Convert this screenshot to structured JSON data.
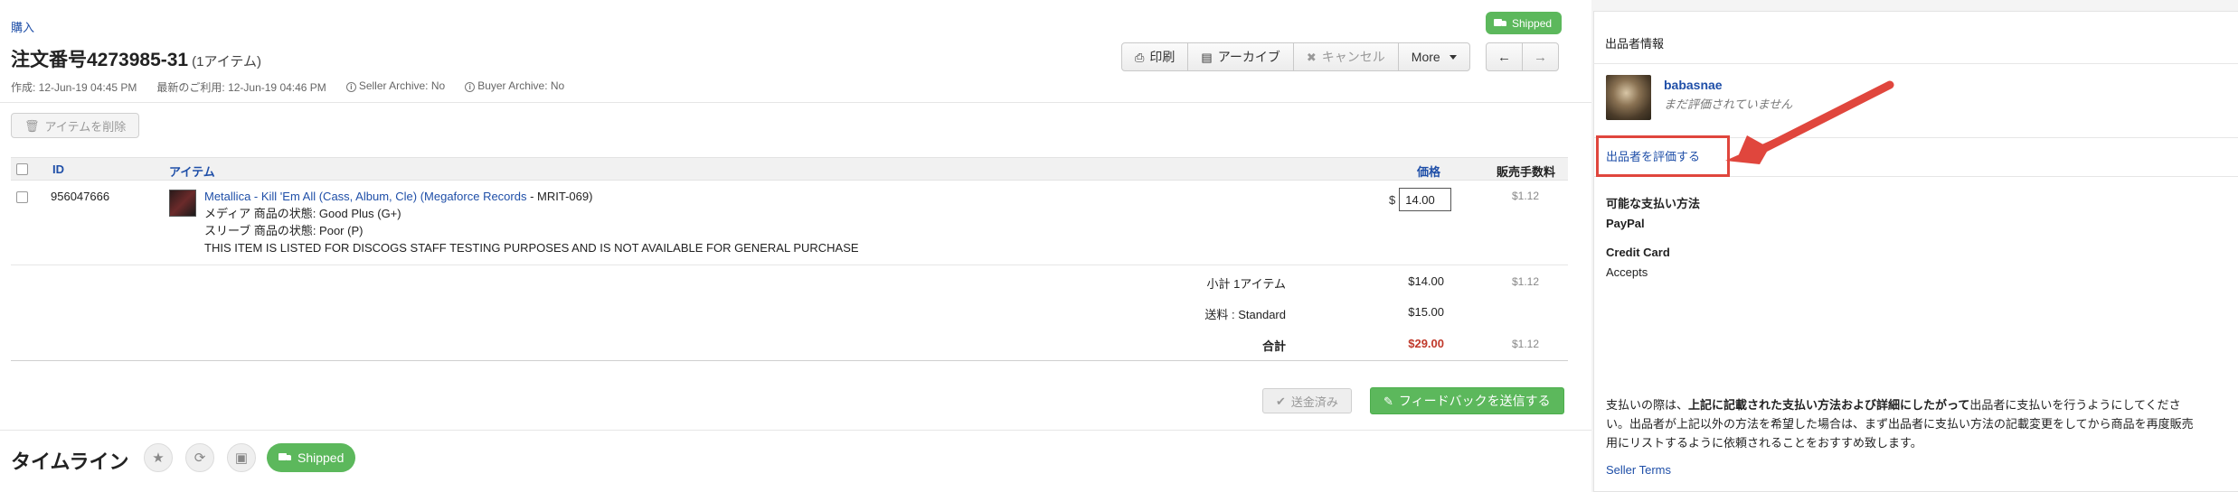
{
  "breadcrumb": "購入",
  "status_badge": "Shipped",
  "order": {
    "title": "注文番号4273985-31",
    "count": "(1アイテム)"
  },
  "toolbar": {
    "print": "印刷",
    "archive": "アーカイブ",
    "cancel": "キャンセル",
    "more": "More",
    "prev": "←",
    "next": "→"
  },
  "meta": {
    "created": "作成: 12-Jun-19 04:45 PM",
    "last_used": "最新のご利用: 12-Jun-19 04:46 PM",
    "seller_archive": "Seller Archive: No",
    "buyer_archive": "Buyer Archive: No"
  },
  "delete_items": "アイテムを削除",
  "table": {
    "headers": {
      "id": "ID",
      "item": "アイテム",
      "price": "価格",
      "fee": "販売手数料"
    },
    "rows": [
      {
        "id": "956047666",
        "title": "Metallica - Kill 'Em All (Cass, Album, Cle) (Megaforce Records",
        "catno": " - MRIT-069)",
        "media": "メディア 商品の状態: Good Plus (G+)",
        "sleeve": "スリーブ 商品の状態: Poor (P)",
        "note": "THIS ITEM IS LISTED FOR DISCOGS STAFF TESTING PURPOSES AND IS NOT AVAILABLE FOR GENERAL PURCHASE",
        "currency": "$",
        "price": "14.00",
        "fee": "$1.12"
      }
    ]
  },
  "summary": {
    "subtotal_label": "小計 1アイテム",
    "subtotal": "$14.00",
    "subtotal_fee": "$1.12",
    "shipping_label": "送料 : Standard",
    "shipping": "$15.00",
    "total_label": "合計",
    "total": "$29.00",
    "total_fee": "$1.12"
  },
  "actions": {
    "paid": "送金済み",
    "feedback": "フィードバックを送信する"
  },
  "timeline": {
    "title": "タイムライン",
    "shipped": "Shipped"
  },
  "sidebar": {
    "title": "出品者情報",
    "seller_name": "babasnae",
    "seller_sub": "まだ評価されていません",
    "rate_seller": "出品者を評価する",
    "payment_title": "可能な支払い方法",
    "payment_method": "PayPal",
    "credit_title": "Credit Card",
    "credit_text": "Accepts",
    "note_pre": "支払いの際は、",
    "note_bold": "上記に記載された支払い方法および詳細にしたがって",
    "note_post": "出品者に支払いを行うようにしてください。出品者が上記以外の方法を希望した場合は、まず出品者に支払い方法の記載変更をしてから商品を再度販売用にリストするように依頼されることをおすすめ致します。",
    "seller_terms": "Seller Terms"
  },
  "colors": {
    "link": "#1f4fa8",
    "success": "#5cb85c",
    "total": "#c0392b",
    "annotation": "#e0463d"
  }
}
